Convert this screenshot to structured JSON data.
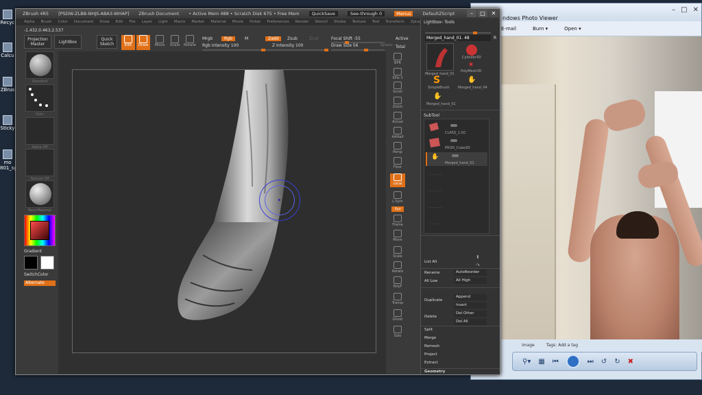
{
  "desktop": {
    "icons": [
      "Recyc",
      "Calcu",
      "ZBrus",
      "Sticky",
      "mo 801_sp"
    ]
  },
  "photo_viewer": {
    "title": "ndows Photo Viewer",
    "menu": [
      "E-mail",
      "Burn",
      "Open"
    ],
    "status_left": "image",
    "status_right": "Tags: Add a tag",
    "controls": [
      "zoom",
      "fit",
      "previous",
      "play",
      "next",
      "rotate-ccw",
      "rotate-cw",
      "delete"
    ]
  },
  "zbrush": {
    "title": "ZBrush 4R5",
    "doc_info": "[PSDW-ZLBB-NHJS-ABA3-WHAP]",
    "doc_label": "ZBrush Document",
    "active_mem": "• Active Mem 488 • Scratch Disk 675 • Free Mem",
    "quicksave": "QuickSave",
    "seethrough": "See-through  0",
    "menus_btn": "Menus",
    "script": "DefaultZScript",
    "menubar": [
      "Alpha",
      "Brush",
      "Color",
      "Document",
      "Draw",
      "Edit",
      "File",
      "Layer",
      "Light",
      "Macro",
      "Marker",
      "Material",
      "Movie",
      "Picker",
      "Preferences",
      "Render",
      "Stencil",
      "Stroke",
      "Texture",
      "Tool",
      "Transform",
      "Zplugin",
      "Zscript"
    ],
    "coords": "-1.432,0.463,2.537",
    "toolbar": {
      "projection_master": "Projection Master",
      "lightbox": "LightBox",
      "quick_sketch": "Quick Sketch",
      "edit": "Edit",
      "draw": "Draw",
      "move": "Move",
      "scale": "Scale",
      "rotate": "Rotate",
      "mrgb": "Mrgb",
      "rgb": "Rgb",
      "m": "M",
      "zadd": "Zadd",
      "zsub": "Zsub",
      "zcut": "Zcut",
      "rgb_intensity": "Rgb Intensity 100",
      "z_intensity": "Z Intensity 100",
      "focal_shift": "Focal Shift -55",
      "draw_size": "Draw Size 56",
      "active": "Active",
      "total": "Total",
      "dynamic": "Dynamic"
    },
    "left_palette": {
      "brush": "Standard",
      "stroke": "Dots",
      "alpha": "Alpha Off",
      "texture": "Texture Off",
      "material": "BasicMaterial",
      "gradient": "Gradient",
      "switch_color": "SwitchColor",
      "alternate": "Alternate"
    },
    "right_shelf": [
      "BPR",
      "SPix 3",
      "Scroll",
      "Zoom",
      "Actual",
      "AAHalf",
      "Persp",
      "Floor",
      "Local",
      "L.Sym",
      "Xyz",
      "Frame",
      "Move",
      "Scale",
      "Rotate",
      "PolyF",
      "Transp",
      "Ghost",
      "Solo"
    ],
    "tool_panel": {
      "header": "Lightbox› Tools",
      "tool_name": "Merged_hand_01. 48",
      "r": "R",
      "tools": [
        "Merged_hand_01",
        "Cylinder3D",
        "PolyMesh3D",
        "SimpleBrush",
        "Merged_hand_04",
        "Merged_hand_01"
      ],
      "subtool_header": "SubTool",
      "subtools": [
        "CLASS_1.OC",
        "PROD_Cube3D",
        "Merged_hand_01"
      ],
      "list_all": "List All",
      "rename": "Rename",
      "autoreorder": "AutoReorder",
      "all_low": "All Low",
      "all_high": "All High",
      "append": "Append",
      "duplicate": "Duplicate",
      "insert": "Insert",
      "delete": "Delete",
      "del_other": "Del Other",
      "del_all": "Del All",
      "split": "Split",
      "merge": "Merge",
      "remesh": "Remesh",
      "project": "Project",
      "extract": "Extract",
      "geometry": "Geometry"
    }
  },
  "colors": {
    "accent": "#e07018",
    "panel": "#3a3a3a",
    "canvas": "#303030"
  }
}
